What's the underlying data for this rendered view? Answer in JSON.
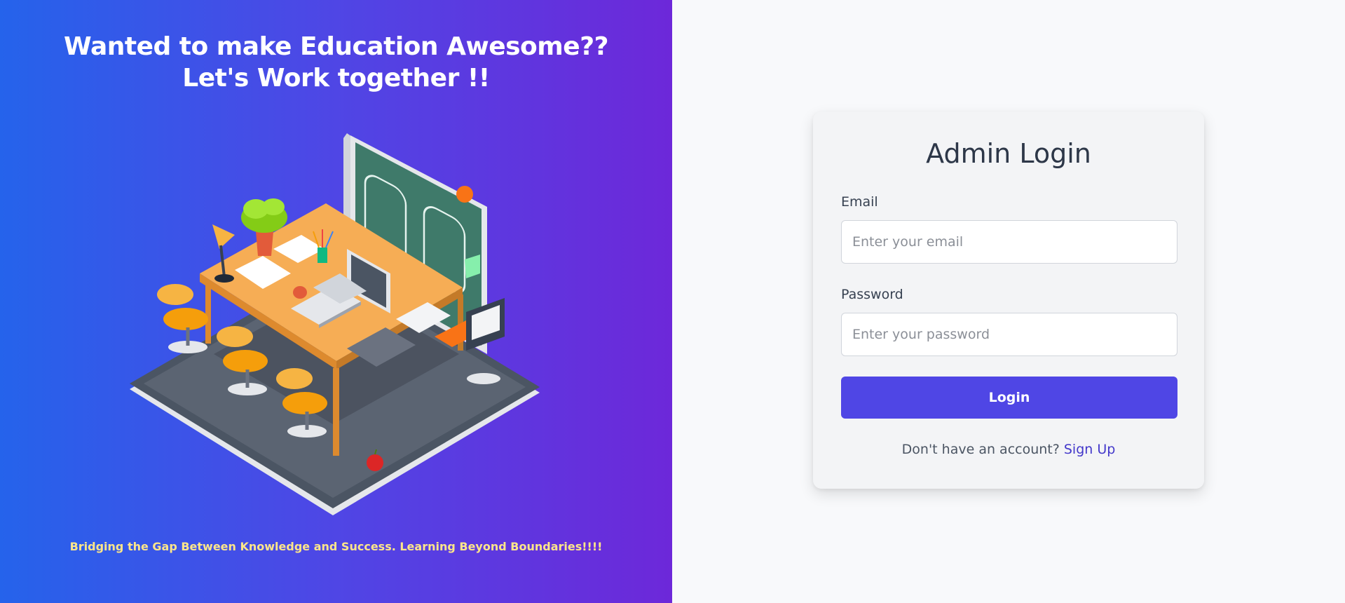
{
  "hero": {
    "title_line1": "Wanted to make Education Awesome??",
    "title_line2": "Let's Work together !!",
    "tagline": "Bridging the Gap Between Knowledge and Success. Learning Beyond Boundaries!!!!"
  },
  "login": {
    "title": "Admin Login",
    "email_label": "Email",
    "email_placeholder": "Enter your email",
    "email_value": "",
    "password_label": "Password",
    "password_placeholder": "Enter your password",
    "password_value": "",
    "submit_label": "Login",
    "signup_prompt": "Don't have an account?",
    "signup_link": "Sign Up"
  },
  "colors": {
    "gradient_start": "#2563eb",
    "gradient_end": "#6d28d9",
    "tagline": "#fde68a",
    "accent": "#4f46e5",
    "card_bg": "#f3f4f6",
    "page_bg": "#f8f9fb"
  }
}
